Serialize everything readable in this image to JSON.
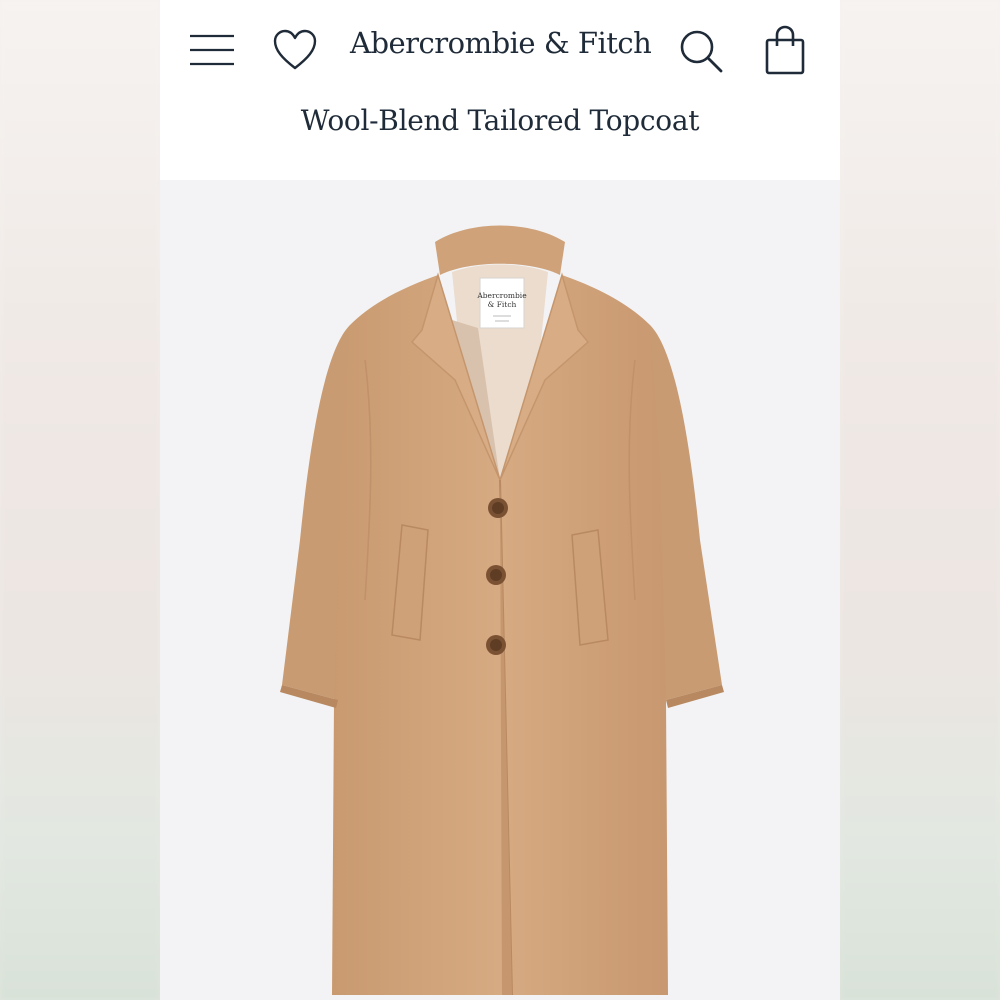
{
  "header": {
    "brand": "Abercrombie & Fitch",
    "menu_icon": "hamburger-menu-icon",
    "wishlist_icon": "heart-icon",
    "search_icon": "search-icon",
    "cart_icon": "shopping-bag-icon"
  },
  "product": {
    "title": "Wool-Blend Tailored Topcoat",
    "image": "coat-image",
    "label_line1": "Abercrombie",
    "label_line2": "& Fitch",
    "color_hex": "#d4a780"
  },
  "colors": {
    "text": "#1f2b38",
    "background": "#ffffff",
    "image_background": "#f3f3f5"
  }
}
